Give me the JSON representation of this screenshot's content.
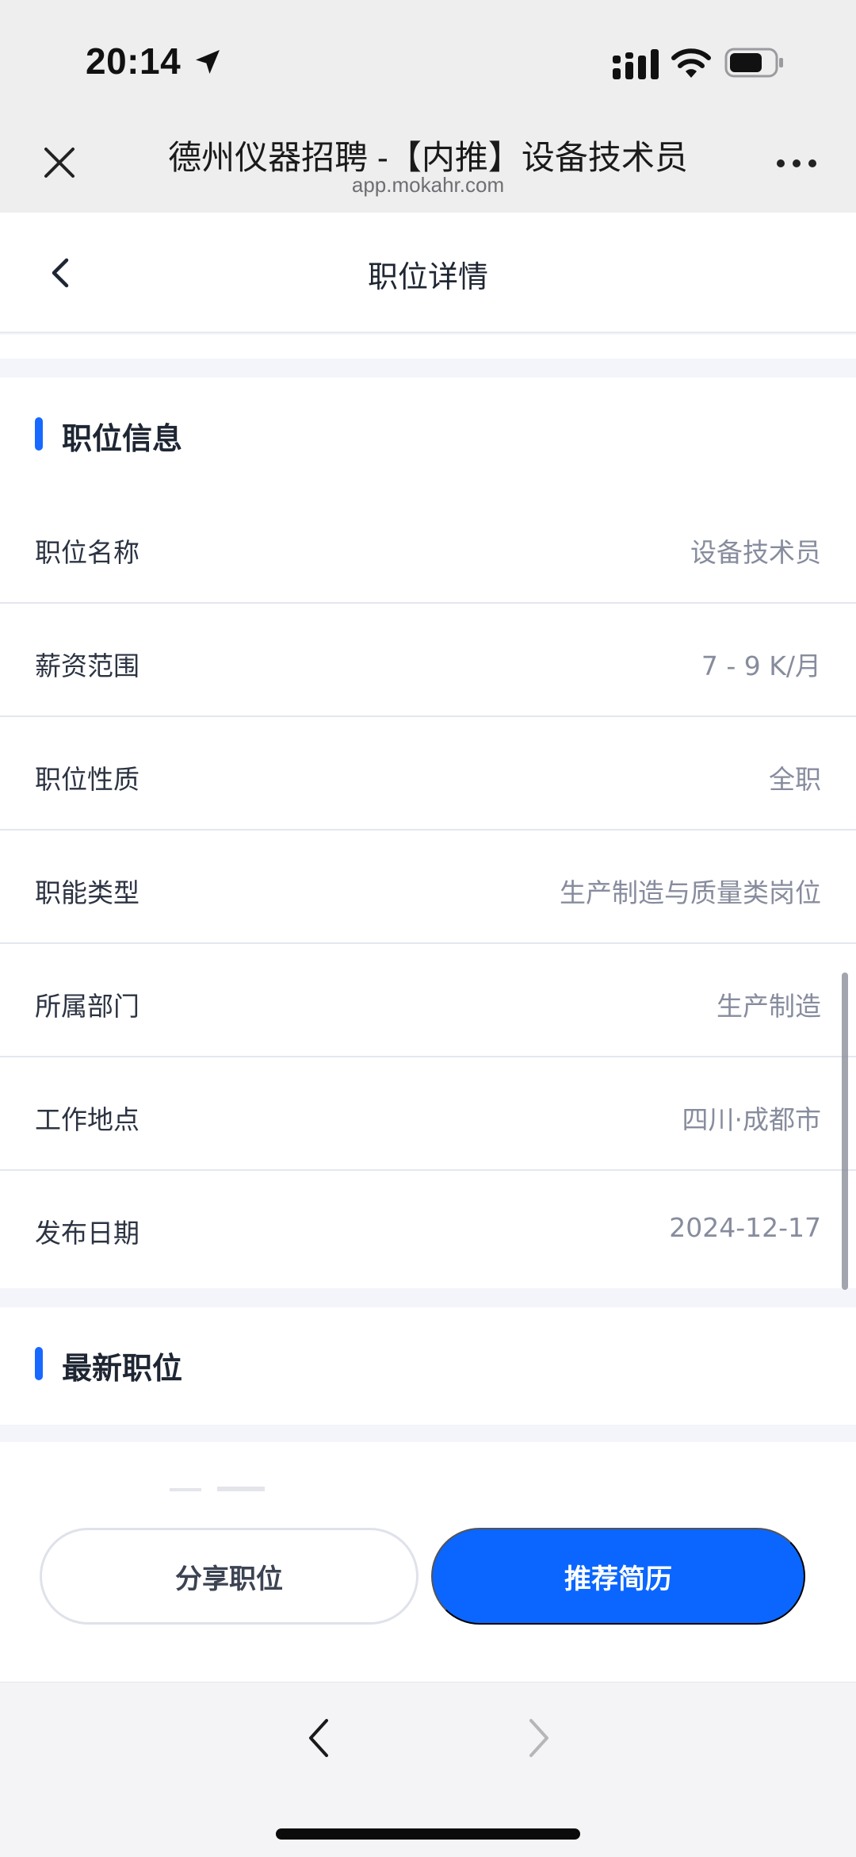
{
  "status_bar": {
    "time": "20:14",
    "icons": [
      "location-arrow-icon",
      "signal-icon",
      "wifi-icon",
      "battery-icon"
    ]
  },
  "browser": {
    "title": "德州仪器招聘 -【内推】设备技术员",
    "url": "app.mokahr.com",
    "close_icon": "close-icon",
    "more_icon": "more-icon"
  },
  "header": {
    "title": "职位详情"
  },
  "job_info": {
    "section_title": "职位信息",
    "rows": [
      {
        "label": "职位名称",
        "value": "设备技术员"
      },
      {
        "label": "薪资范围",
        "value": "7 - 9 K/月"
      },
      {
        "label": "职位性质",
        "value": "全职"
      },
      {
        "label": "职能类型",
        "value": "生产制造与质量类岗位"
      },
      {
        "label": "所属部门",
        "value": "生产制造"
      },
      {
        "label": "工作地点",
        "value": "四川·成都市"
      },
      {
        "label": "发布日期",
        "value": "2024-12-17"
      }
    ]
  },
  "latest_jobs": {
    "section_title": "最新职位"
  },
  "actions": {
    "share_label": "分享职位",
    "recommend_label": "推荐简历"
  },
  "colors": {
    "accent": "#0a66ff",
    "section_bar": "#1769ff",
    "label_text": "#2c3342",
    "value_text": "#878c9d"
  }
}
